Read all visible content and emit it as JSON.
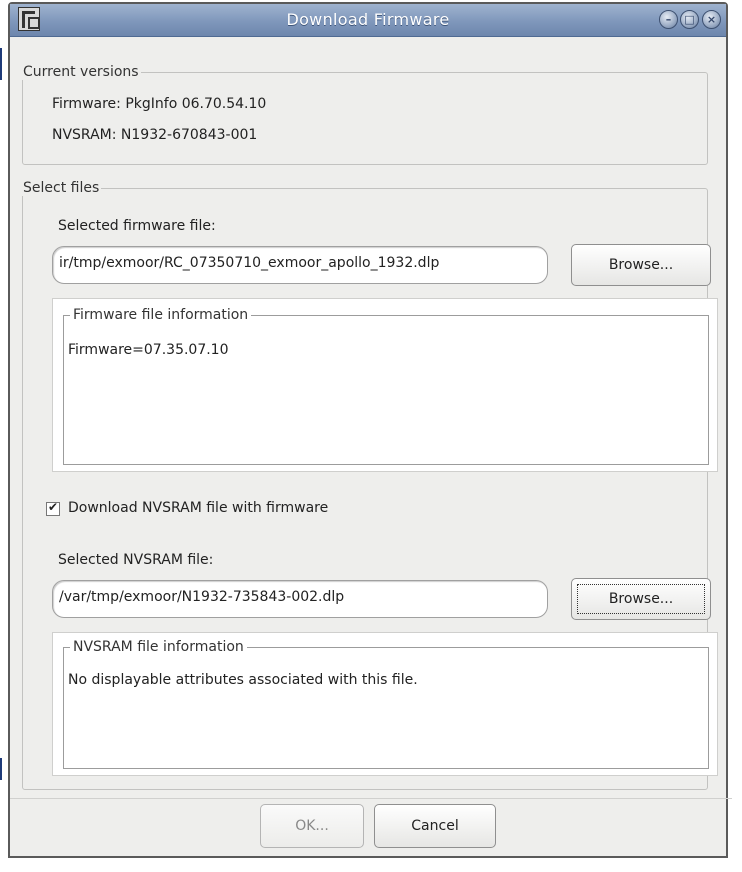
{
  "window": {
    "title": "Download Firmware",
    "buttons": {
      "minimize_icon": "minimize-icon",
      "maximize_icon": "maximize-icon",
      "close_icon": "close-icon"
    }
  },
  "current_versions": {
    "legend": "Current versions",
    "firmware": "Firmware: PkgInfo 06.70.54.10",
    "nvsram": "NVSRAM: N1932-670843-001"
  },
  "select_files": {
    "legend": "Select files",
    "firmware_label": "Selected firmware file:",
    "firmware_path": "ir/tmp/exmoor/RC_07350710_exmoor_apollo_1932.dlp",
    "browse1": "Browse...",
    "fw_info_legend": "Firmware file information",
    "fw_info_text": "Firmware=07.35.07.10",
    "nvsram_checkbox_label": "Download NVSRAM file with firmware",
    "nvsram_checkbox_checked": true,
    "nvsram_label": "Selected NVSRAM file:",
    "nvsram_path": "/var/tmp/exmoor/N1932-735843-002.dlp",
    "browse2": "Browse...",
    "nv_info_legend": "NVSRAM file information",
    "nv_info_text": "No displayable attributes associated with this file."
  },
  "footer": {
    "ok": "OK...",
    "cancel": "Cancel"
  }
}
